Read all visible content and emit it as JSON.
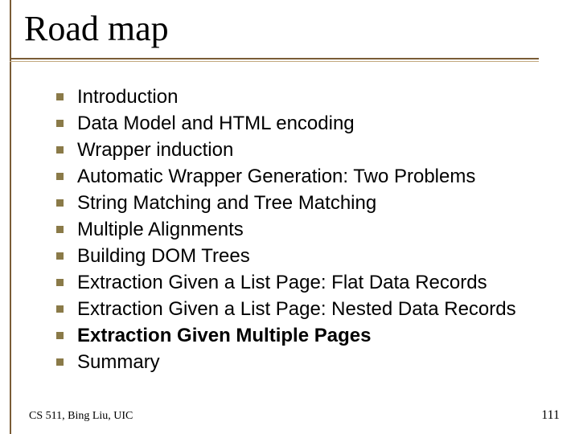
{
  "title": "Road map",
  "bullets": [
    {
      "text": "Introduction",
      "bold": false
    },
    {
      "text": "Data Model and HTML encoding",
      "bold": false
    },
    {
      "text": "Wrapper induction",
      "bold": false
    },
    {
      "text": "Automatic Wrapper Generation: Two Problems",
      "bold": false
    },
    {
      "text": "String Matching and Tree Matching",
      "bold": false
    },
    {
      "text": "Multiple Alignments",
      "bold": false
    },
    {
      "text": "Building DOM Trees",
      "bold": false
    },
    {
      "text": "Extraction Given a List Page: Flat Data Records",
      "bold": false
    },
    {
      "text": "Extraction Given a List Page: Nested Data Records",
      "bold": false
    },
    {
      "text": "Extraction Given Multiple Pages",
      "bold": true
    },
    {
      "text": "Summary",
      "bold": false
    }
  ],
  "footer": {
    "left": "CS 511, Bing Liu, UIC",
    "page": "111"
  }
}
